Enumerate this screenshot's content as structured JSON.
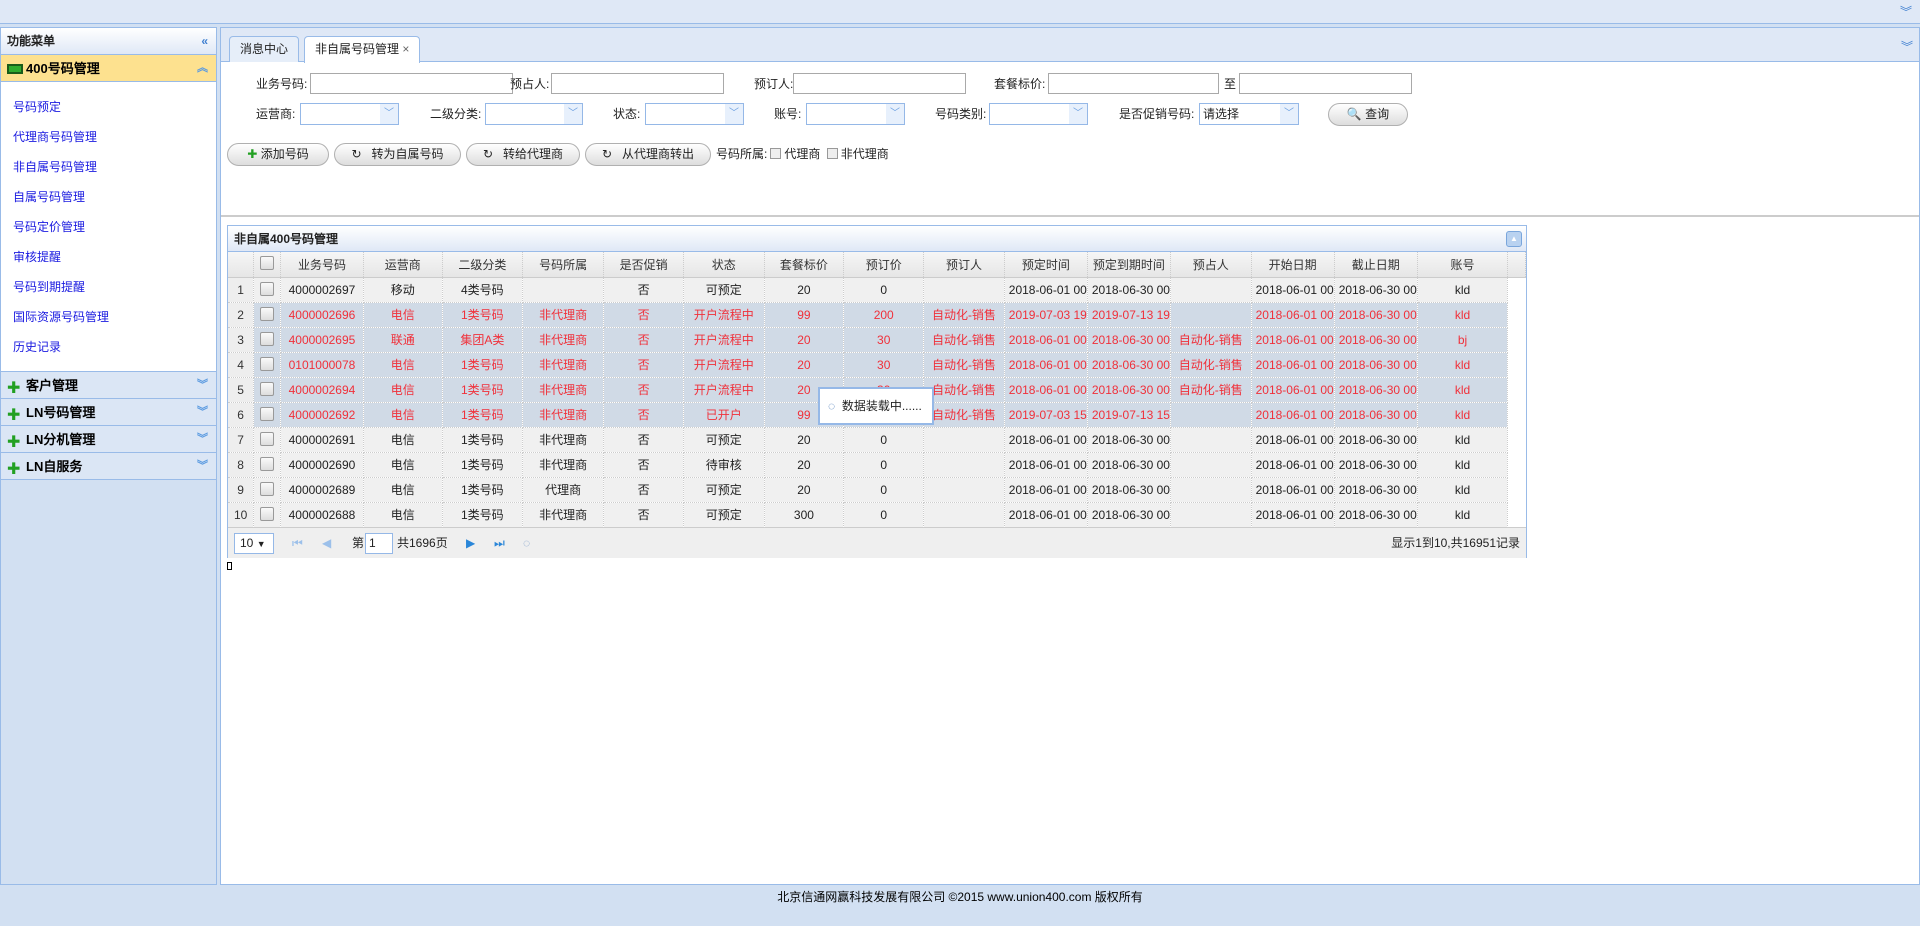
{
  "sidebar": {
    "title": "功能菜单",
    "open_section": "400号码管理",
    "items": [
      "号码预定",
      "代理商号码管理",
      "非自属号码管理",
      "自属号码管理",
      "号码定价管理",
      "审核提醒",
      "号码到期提醒",
      "国际资源号码管理",
      "历史记录"
    ],
    "sections": [
      "客户管理",
      "LN号码管理",
      "LN分机管理",
      "LN自服务"
    ]
  },
  "tabs": [
    {
      "label": "消息中心"
    },
    {
      "label": "非自属号码管理",
      "close": "×"
    }
  ],
  "form": {
    "business_no": "业务号码:",
    "preoccupant": "预占人:",
    "reserver": "预订人:",
    "package_price": "套餐标价:",
    "to": "至",
    "carrier": "运营商:",
    "sub_category": "二级分类:",
    "status": "状态:",
    "account": "账号:",
    "number_type": "号码类别:",
    "is_promo": "是否促销号码:",
    "is_promo_value": "请选择",
    "query": "查询"
  },
  "toolbar": {
    "add": "添加号码",
    "to_own": "转为自属号码",
    "to_agent": "转给代理商",
    "from_agent": "从代理商转出",
    "ownership": "号码所属:",
    "agent": "代理商",
    "non_agent": "非代理商"
  },
  "grid": {
    "title": "非自属400号码管理",
    "columns": [
      "业务号码",
      "运营商",
      "二级分类",
      "号码所属",
      "是否促销",
      "状态",
      "套餐标价",
      "预订价",
      "预订人",
      "预定时间",
      "预定到期时间",
      "预占人",
      "开始日期",
      "截止日期",
      "账号"
    ],
    "rows": [
      {
        "highlight": false,
        "cells": [
          "4000002697",
          "移动",
          "4类号码",
          "",
          "否",
          "可预定",
          "20",
          "0",
          "",
          "2018-06-01 00",
          "2018-06-30 00",
          "",
          "2018-06-01 00",
          "2018-06-30 00",
          "kld"
        ]
      },
      {
        "highlight": true,
        "cells": [
          "4000002696",
          "电信",
          "1类号码",
          "非代理商",
          "否",
          "开户流程中",
          "99",
          "200",
          "自动化-销售",
          "2019-07-03 19",
          "2019-07-13 19",
          "",
          "2018-06-01 00",
          "2018-06-30 00",
          "kld"
        ]
      },
      {
        "highlight": true,
        "cells": [
          "4000002695",
          "联通",
          "集团A类",
          "非代理商",
          "否",
          "开户流程中",
          "20",
          "30",
          "自动化-销售",
          "2018-06-01 00",
          "2018-06-30 00",
          "自动化-销售",
          "2018-06-01 00",
          "2018-06-30 00",
          "bj"
        ]
      },
      {
        "highlight": true,
        "cells": [
          "0101000078",
          "电信",
          "1类号码",
          "非代理商",
          "否",
          "开户流程中",
          "20",
          "30",
          "自动化-销售",
          "2018-06-01 00",
          "2018-06-30 00",
          "自动化-销售",
          "2018-06-01 00",
          "2018-06-30 00",
          "kld"
        ]
      },
      {
        "highlight": true,
        "cells": [
          "4000002694",
          "电信",
          "1类号码",
          "非代理商",
          "否",
          "开户流程中",
          "20",
          "30",
          "自动化-销售",
          "2018-06-01 00",
          "2018-06-30 00",
          "自动化-销售",
          "2018-06-01 00",
          "2018-06-30 00",
          "kld"
        ]
      },
      {
        "highlight": true,
        "cells": [
          "4000002692",
          "电信",
          "1类号码",
          "非代理商",
          "否",
          "已开户",
          "99",
          "",
          "自动化-销售",
          "2019-07-03 15",
          "2019-07-13 15",
          "",
          "2018-06-01 00",
          "2018-06-30 00",
          "kld"
        ]
      },
      {
        "highlight": false,
        "cells": [
          "4000002691",
          "电信",
          "1类号码",
          "非代理商",
          "否",
          "可预定",
          "20",
          "0",
          "",
          "2018-06-01 00",
          "2018-06-30 00",
          "",
          "2018-06-01 00",
          "2018-06-30 00",
          "kld"
        ]
      },
      {
        "highlight": false,
        "cells": [
          "4000002690",
          "电信",
          "1类号码",
          "非代理商",
          "否",
          "待审核",
          "20",
          "0",
          "",
          "2018-06-01 00",
          "2018-06-30 00",
          "",
          "2018-06-01 00",
          "2018-06-30 00",
          "kld"
        ]
      },
      {
        "highlight": false,
        "cells": [
          "4000002689",
          "电信",
          "1类号码",
          "代理商",
          "否",
          "可预定",
          "20",
          "0",
          "",
          "2018-06-01 00",
          "2018-06-30 00",
          "",
          "2018-06-01 00",
          "2018-06-30 00",
          "kld"
        ]
      },
      {
        "highlight": false,
        "cells": [
          "4000002688",
          "电信",
          "1类号码",
          "非代理商",
          "否",
          "可预定",
          "300",
          "0",
          "",
          "2018-06-01 00",
          "2018-06-30 00",
          "",
          "2018-06-01 00",
          "2018-06-30 00",
          "kld"
        ]
      }
    ],
    "loading": "数据装载中......"
  },
  "pager": {
    "page_size": "10",
    "page_prefix": "第",
    "page": "1",
    "total_pages": "共1696页",
    "summary": "显示1到10,共16951记录"
  },
  "footer": "北京信通网赢科技发展有限公司 ©2015 www.union400.com 版权所有"
}
